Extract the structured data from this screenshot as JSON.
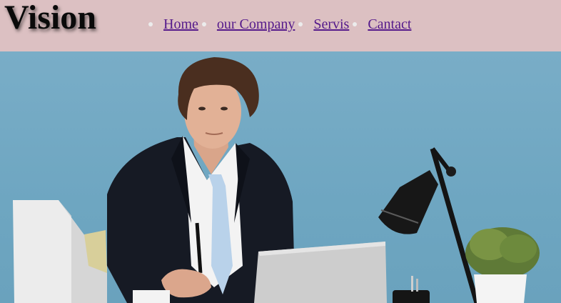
{
  "brand": {
    "name": "Vision"
  },
  "nav": {
    "items": [
      {
        "label": "Home"
      },
      {
        "label": "our Company"
      },
      {
        "label": "Servis"
      },
      {
        "label": "Cantact"
      }
    ]
  },
  "colors": {
    "header_bg": "#dcc0c2",
    "link": "#551a8b",
    "hero_bg": "#79adc7"
  },
  "hero": {
    "image_subject": "man in suit at desk with laptop, desk lamp and plant"
  }
}
